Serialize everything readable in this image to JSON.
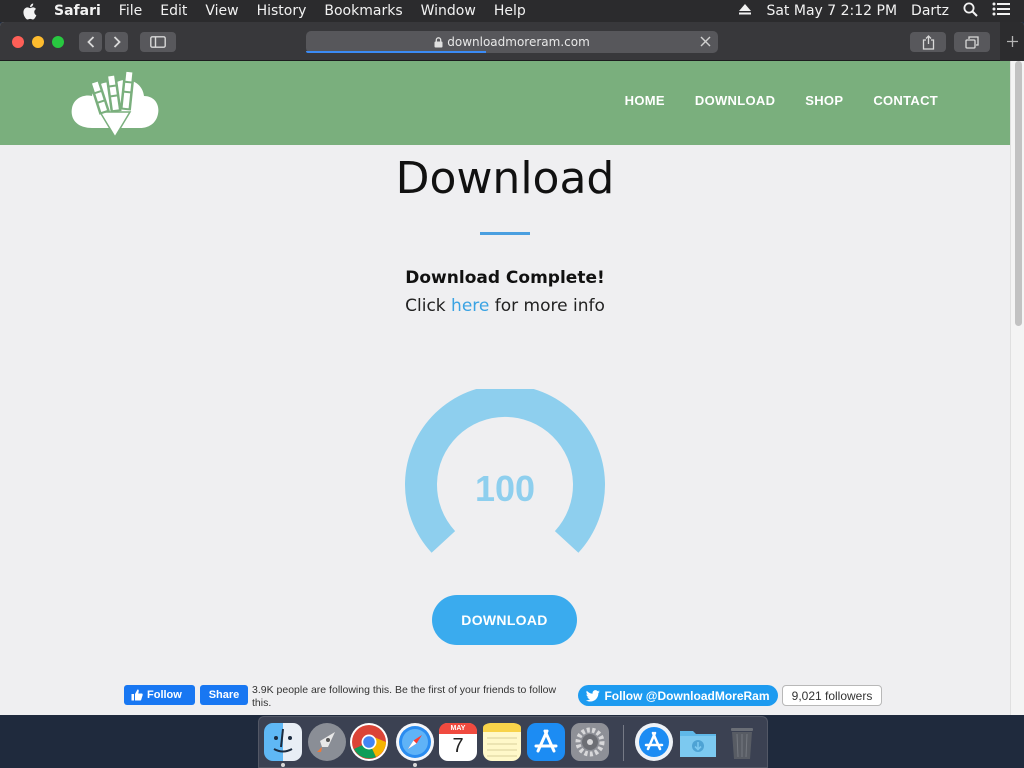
{
  "menubar": {
    "app_name": "Safari",
    "menus": [
      "File",
      "Edit",
      "View",
      "History",
      "Bookmarks",
      "Window",
      "Help"
    ],
    "clock": "Sat May 7  2:12 PM",
    "user": "Dartz"
  },
  "browser": {
    "url": "downloadmoreram.com"
  },
  "site": {
    "nav": [
      "HOME",
      "DOWNLOAD",
      "SHOP",
      "CONTACT"
    ],
    "title": "Download",
    "status_heading": "Download Complete!",
    "info_prefix": "Click ",
    "info_link": "here",
    "info_suffix": " for more info",
    "gauge_value": "100",
    "download_button": "DOWNLOAD"
  },
  "social": {
    "fb_follow": "Follow",
    "fb_share": "Share",
    "fb_text": "3.9K people are following this. Be the first of your friends to follow this.",
    "tw_follow": "Follow @DownloadMoreRam",
    "tw_followers": "9,021 followers"
  },
  "dock": {
    "calendar_month": "MAY",
    "calendar_day": "7"
  },
  "colors": {
    "header_green": "#7aaf7d",
    "accent_blue": "#3aabee",
    "gauge_blue": "#8ecfee",
    "link_blue": "#3aa3e3"
  }
}
